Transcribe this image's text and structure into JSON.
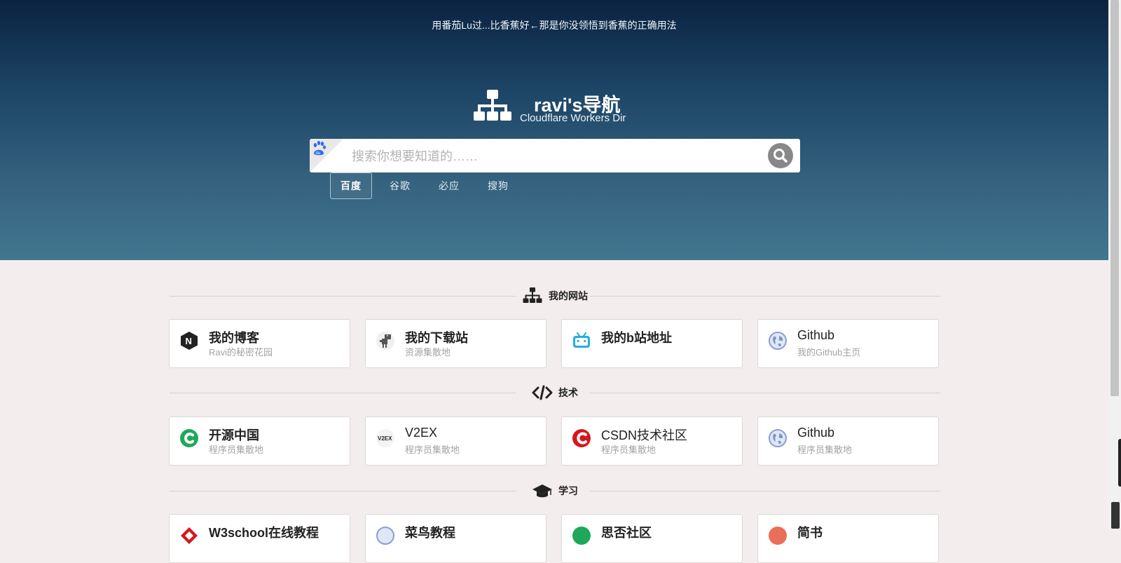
{
  "hero": {
    "marquee": "用番茄Lu过...比香蕉好←那是你没领悟到香蕉的正确用法",
    "title": "ravi's导航",
    "subtitle": "Cloudflare Workers Dir"
  },
  "search": {
    "placeholder": "搜索你想要知道的……",
    "value": "",
    "engine_icon": "baidu-paw-icon",
    "button_icon": "search-icon"
  },
  "engines": [
    "百度",
    "谷歌",
    "必应",
    "搜狗"
  ],
  "active_engine": "百度",
  "sections": [
    {
      "title": "我的网站",
      "icon": "sitemap-icon",
      "cards": [
        {
          "name": "我的博客",
          "desc": "Ravi的秘密花园",
          "icon": "nginx-n-icon"
        },
        {
          "name": "我的下载站",
          "desc": "资源集散地",
          "icon": "dino-icon"
        },
        {
          "name": "我的b站地址",
          "desc": "",
          "icon": "bilibili-icon"
        },
        {
          "name": "Github",
          "desc": "我的Github主页",
          "icon": "globe-icon"
        }
      ]
    },
    {
      "title": "技术",
      "icon": "code-icon",
      "cards": [
        {
          "name": "开源中国",
          "desc": "程序员集散地",
          "icon": "oschina-icon"
        },
        {
          "name": "V2EX",
          "desc": "程序员集散地",
          "icon": "v2ex-icon"
        },
        {
          "name": "CSDN技术社区",
          "desc": "程序员集散地",
          "icon": "csdn-icon"
        },
        {
          "name": "Github",
          "desc": "程序员集散地",
          "icon": "globe-icon"
        }
      ]
    },
    {
      "title": "学习",
      "icon": "graduation-cap-icon",
      "cards": [
        {
          "name": "W3school在线教程",
          "desc": "",
          "icon": "w3school-icon"
        },
        {
          "name": "菜鸟教程",
          "desc": "",
          "icon": "runoob-icon"
        },
        {
          "name": "思否社区",
          "desc": "",
          "icon": "segmentfault-icon"
        },
        {
          "name": "简书",
          "desc": "",
          "icon": "jianshu-icon"
        }
      ]
    }
  ],
  "colors": {
    "hero_top": "#0b2340",
    "hero_bottom": "#42768f",
    "page_bg": "#f3eded",
    "oschina": "#1fa85a",
    "csdn": "#d8161b",
    "bilibili": "#23ade5"
  }
}
